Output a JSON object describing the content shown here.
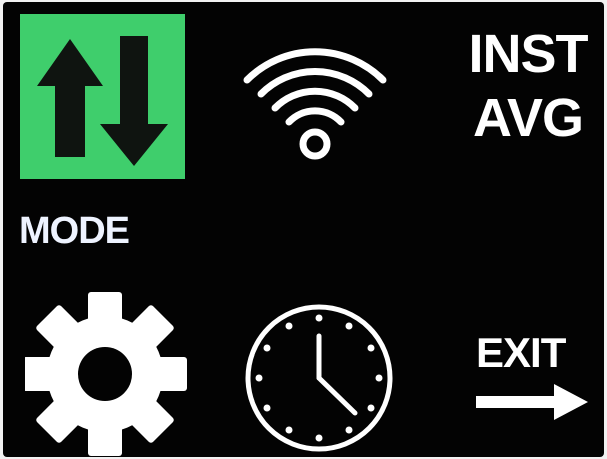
{
  "menu": {
    "mode": {
      "label": "MODE",
      "icon": "up-down-arrows-icon",
      "highlight_color": "#3fce6c",
      "selected": true
    },
    "wifi": {
      "icon": "wifi-icon"
    },
    "display": {
      "line1": "INST",
      "line2": "AVG"
    },
    "settings": {
      "icon": "gear-icon"
    },
    "clock": {
      "icon": "clock-icon"
    },
    "exit": {
      "label": "EXIT",
      "icon": "right-arrow-icon"
    }
  },
  "colors": {
    "background": "#030303",
    "foreground": "#ffffff",
    "accent": "#3fce6c"
  }
}
